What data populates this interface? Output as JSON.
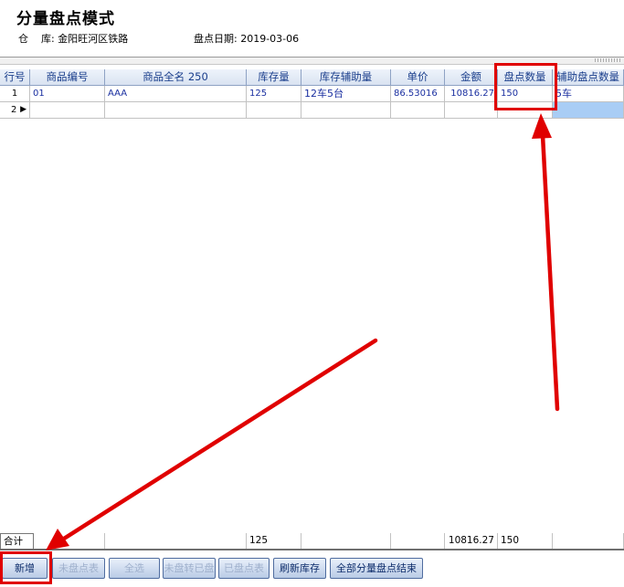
{
  "header": {
    "title": "分量盘点模式",
    "warehouse_label": "仓    库:",
    "warehouse_value": "金阳旺河区铁路",
    "date_label": "盘点日期:",
    "date_value": "2019-03-06"
  },
  "table": {
    "columns": [
      "行号",
      "商品编号",
      "商品全名 250",
      "库存量",
      "库存辅助量",
      "单价",
      "金额",
      "盘点数量",
      "辅助盘点数量"
    ],
    "rows": [
      [
        "1",
        "01",
        "AAA",
        "125",
        "12车5台",
        "86.53016",
        "10816.27",
        "150",
        "5车"
      ],
      [
        "2",
        "",
        "",
        "",
        "",
        "",
        "",
        "",
        ""
      ]
    ],
    "row_indicator": "▶",
    "totals": [
      "合计",
      "",
      "",
      "125",
      "",
      "",
      "10816.27",
      "150",
      ""
    ]
  },
  "buttons": {
    "add": "新增",
    "not_counted": "未盘点表",
    "select_all": "全选",
    "uncounted_to_counted": "未盘转已盘",
    "counted": "已盘点表",
    "refresh": "刷新库存",
    "finish_all": "全部分量盘点结束"
  },
  "colors": {
    "highlight": "#e00000",
    "header_text": "#1a3e8c",
    "button_text": "#0e2d6b"
  }
}
